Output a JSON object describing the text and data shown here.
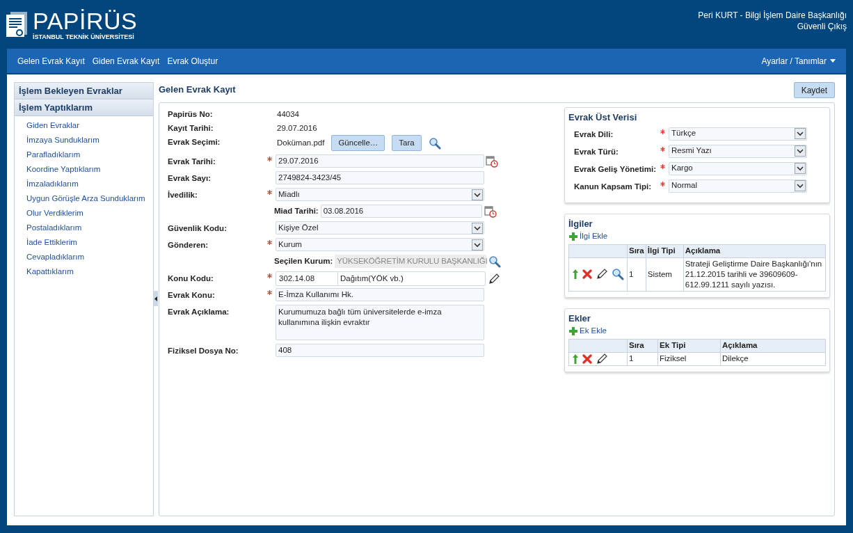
{
  "header": {
    "logo_title": "PAPİRÜS",
    "logo_subtitle": "İSTANBUL TEKNİK ÜNİVERSİTESİ",
    "user": "Peri KURT - Bilgi İşlem Daire Başkanlığı",
    "logout": "Güvenli Çıkış"
  },
  "nav": {
    "items": [
      "Gelen Evrak Kayıt",
      "Giden Evrak Kayıt",
      "Evrak Oluştur"
    ],
    "settings": "Ayarlar / Tanımlar"
  },
  "sidebar": {
    "sections": [
      {
        "title": "İşlem Bekleyen Evraklar"
      },
      {
        "title": "İşlem Yaptıklarım",
        "items": [
          "Giden Evraklar",
          "İmzaya Sunduklarım",
          "Parafladıklarım",
          "Koordine Yaptıklarım",
          "İmzaladıklarım",
          "Uygun Görüşle Arza Sunduklarım",
          "Olur Verdiklerim",
          "Postaladıklarım",
          "İade Ettiklerim",
          "Cevapladıklarım",
          "Kapattıklarım"
        ]
      }
    ]
  },
  "page": {
    "title": "Gelen Evrak Kayıt",
    "save_button": "Kaydet"
  },
  "form": [
    {
      "kind": "static",
      "label": "Papirüs No:",
      "required": false,
      "value": "44034"
    },
    {
      "kind": "static",
      "label": "Kayıt Tarihi:",
      "required": false,
      "value": "29.07.2016"
    },
    {
      "kind": "file",
      "label": "Evrak Seçimi:",
      "required": false,
      "value": "Doküman.pdf",
      "buttons": [
        "Güncelle…",
        "Tara"
      ]
    },
    {
      "kind": "date",
      "label": "Evrak Tarihi:",
      "required": true,
      "value": "29.07.2016"
    },
    {
      "kind": "text",
      "label": "Evrak Sayı:",
      "required": false,
      "value": "2749824-3423/45"
    },
    {
      "kind": "select",
      "label": "İvedilik:",
      "required": true,
      "value": "Miadlı",
      "sub": {
        "kind": "date",
        "label": "Miad Tarihi:",
        "value": "03.08.2016"
      }
    },
    {
      "kind": "select",
      "label": "Güvenlik Kodu:",
      "required": false,
      "value": "Kişiye Özel"
    },
    {
      "kind": "select",
      "label": "Gönderen:",
      "required": true,
      "value": "Kurum",
      "sub": {
        "kind": "lookup",
        "label": "Seçilen Kurum:",
        "value": "YÜKSEKÖĞRETİM KURULU BAŞKANLIĞI"
      }
    },
    {
      "kind": "code",
      "label": "Konu Kodu:",
      "required": true,
      "value": "302.14.08",
      "value_2": "Dağıtım(YÖK vb.)"
    },
    {
      "kind": "text",
      "label": "Evrak Konu:",
      "required": true,
      "value": "E-İmza Kullanımı Hk."
    },
    {
      "kind": "textarea",
      "label": "Evrak Açıklama:",
      "required": false,
      "value": "Kurumumuza bağlı tüm üniversitelerde e-imza kullanımına ilişkin evraktır"
    },
    {
      "kind": "text",
      "label": "Fiziksel Dosya No:",
      "required": false,
      "value": "408"
    }
  ],
  "metadata": {
    "title": "Evrak Üst Verisi",
    "fields": [
      {
        "label": "Evrak Dili:",
        "required": true,
        "value": "Türkçe"
      },
      {
        "label": "Evrak Türü:",
        "required": true,
        "value": "Resmi Yazı"
      },
      {
        "label": "Evrak Geliş Yönetimi:",
        "required": true,
        "value": "Kargo"
      },
      {
        "label": "Kanun Kapsam Tipi:",
        "required": true,
        "value": "Normal"
      }
    ]
  },
  "grids": [
    {
      "title": "İlgiler",
      "add_label": "İlgi Ekle",
      "columns": [
        "Sıra",
        "İlgi Tipi",
        "Açıklama"
      ],
      "show_view": true,
      "rows": [
        [
          "1",
          "Sistem",
          "Strateji Geliştirme Daire Başkanlığı'nın 21.12.2015 tarihli ve 39609609-612.99.1211 sayılı yazısı."
        ]
      ]
    },
    {
      "title": "Ekler",
      "add_label": "Ek Ekle",
      "columns": [
        "Sıra",
        "Ek Tipi",
        "Açıklama"
      ],
      "show_view": false,
      "rows": [
        [
          "1",
          "Fiziksel",
          "Dilekçe"
        ]
      ]
    }
  ]
}
